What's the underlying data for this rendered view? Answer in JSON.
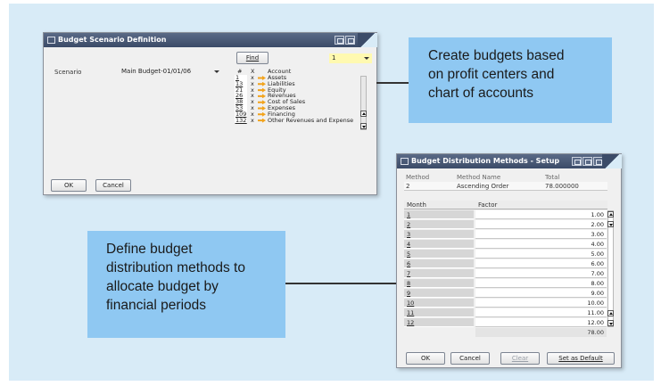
{
  "scenario_window": {
    "title": "Budget Scenario Definition",
    "find_button": "Find",
    "find_combo_value": "1",
    "scenario_label": "Scenario",
    "scenario_value": "Main Budget-01/01/06",
    "grid_headers": {
      "num": "#",
      "x": "X",
      "account": "Account"
    },
    "rows": [
      {
        "num": "1",
        "x": "x",
        "account": "Assets"
      },
      {
        "num": "13",
        "x": "x",
        "account": "Liabilities"
      },
      {
        "num": "21",
        "x": "x",
        "account": "Equity"
      },
      {
        "num": "26",
        "x": "x",
        "account": "Revenues"
      },
      {
        "num": "38",
        "x": "x",
        "account": "Cost of Sales"
      },
      {
        "num": "53",
        "x": "x",
        "account": "Expenses"
      },
      {
        "num": "109",
        "x": "x",
        "account": "Financing"
      },
      {
        "num": "132",
        "x": "x",
        "account": "Other Revenues and Expense"
      }
    ],
    "ok_button": "OK",
    "cancel_button": "Cancel"
  },
  "distribution_window": {
    "title": "Budget Distribution Methods - Setup",
    "headers": {
      "method": "Method",
      "method_name": "Method Name",
      "total": "Total"
    },
    "values": {
      "method": "2",
      "method_name": "Ascending Order",
      "total": "78.000000"
    },
    "grid_headers": {
      "month": "Month",
      "factor": "Factor"
    },
    "rows": [
      {
        "month": "1",
        "factor": "1.00"
      },
      {
        "month": "2",
        "factor": "2.00"
      },
      {
        "month": "3",
        "factor": "3.00"
      },
      {
        "month": "4",
        "factor": "4.00"
      },
      {
        "month": "5",
        "factor": "5.00"
      },
      {
        "month": "6",
        "factor": "6.00"
      },
      {
        "month": "7",
        "factor": "7.00"
      },
      {
        "month": "8",
        "factor": "8.00"
      },
      {
        "month": "9",
        "factor": "9.00"
      },
      {
        "month": "10",
        "factor": "10.00"
      },
      {
        "month": "11",
        "factor": "11.00"
      },
      {
        "month": "12",
        "factor": "12.00"
      }
    ],
    "grid_total": "78.00",
    "ok_button": "OK",
    "cancel_button": "Cancel",
    "clear_button": "Clear",
    "default_button": "Set as Default"
  },
  "callouts": {
    "top_right": [
      "Create budgets based",
      "on profit centers and",
      "chart of accounts"
    ],
    "bottom_left": [
      "Define budget",
      "distribution methods to",
      "allocate budget by",
      "financial periods"
    ]
  },
  "colors": {
    "background": "#d8ebf7",
    "callout": "#8fc8f2",
    "titlebar": "#3b4b68",
    "arrow_icon": "#f2a31b",
    "combo_highlight": "#fff9b0"
  }
}
